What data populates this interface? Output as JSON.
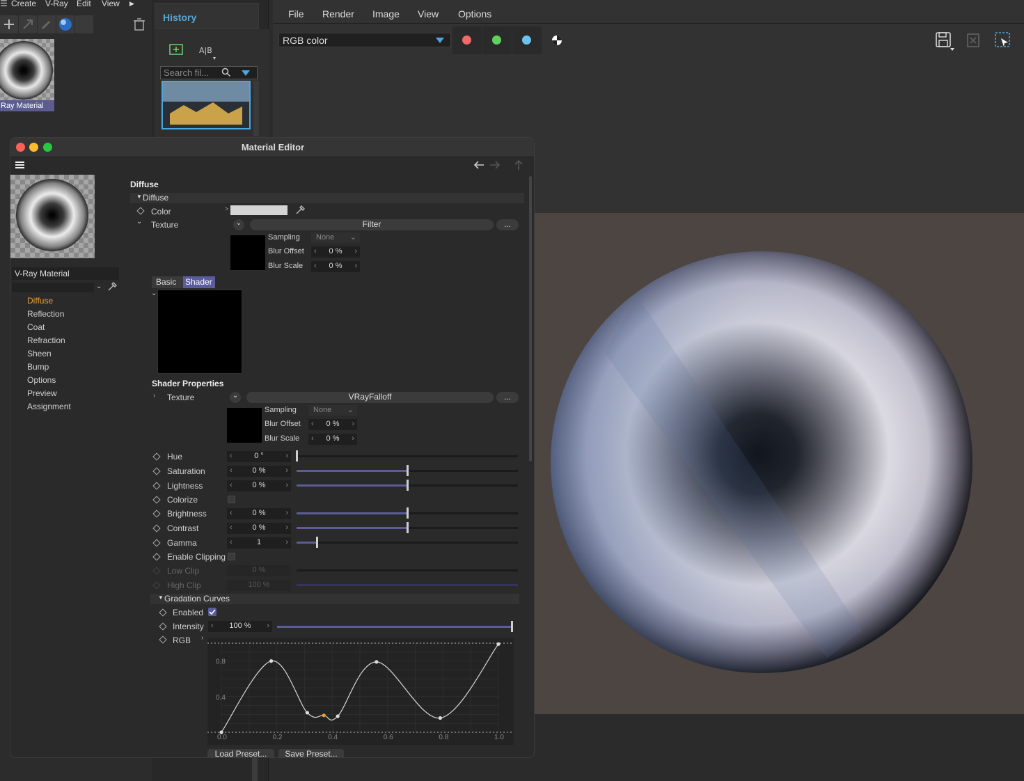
{
  "top_menu": {
    "items": [
      "Create",
      "V-Ray",
      "Edit",
      "View"
    ]
  },
  "thumb": {
    "label": "Ray Material"
  },
  "history": {
    "tab": "History",
    "search_placeholder": "Search fil..."
  },
  "viewport": {
    "menu": [
      "File",
      "Render",
      "Image",
      "View",
      "Options"
    ],
    "channel_select": "RGB color",
    "channel_colors": [
      "#f06a6a",
      "#5ed15e",
      "#6cc3ee"
    ]
  },
  "editor": {
    "title": "Material Editor",
    "material_name": "V-Ray Material",
    "nav": [
      "Diffuse",
      "Reflection",
      "Coat",
      "Refraction",
      "Sheen",
      "Bump",
      "Options",
      "Preview",
      "Assignment"
    ],
    "section_title": "Diffuse",
    "group_title": "Diffuse",
    "color_label": "Color",
    "texture_label": "Texture",
    "filter_label": "Filter",
    "more": "...",
    "sampling_label": "Sampling",
    "sampling_value": "None",
    "blur_offset_label": "Blur Offset",
    "blur_offset_value": "0 %",
    "blur_scale_label": "Blur Scale",
    "blur_scale_value": "0 %",
    "tabs": [
      "Basic",
      "Shader"
    ],
    "shader_props_title": "Shader Properties",
    "shader_texture_label": "Texture",
    "shader_name": "VRayFalloff",
    "sampling2_value": "None",
    "blur_offset2_value": "0 %",
    "blur_scale2_value": "0 %",
    "params": [
      {
        "label": "Hue",
        "value": "0 °",
        "level": 0.0
      },
      {
        "label": "Saturation",
        "value": "0 %",
        "level": 0.5
      },
      {
        "label": "Lightness",
        "value": "0 %",
        "level": 0.5
      },
      {
        "label": "Colorize",
        "value": "",
        "level": null
      },
      {
        "label": "Brightness",
        "value": "0 %",
        "level": 0.5
      },
      {
        "label": "Contrast",
        "value": "0 %",
        "level": 0.5
      },
      {
        "label": "Gamma",
        "value": "1",
        "level": 0.09
      },
      {
        "label": "Enable Clipping",
        "value": "",
        "level": null
      },
      {
        "label": "Low Clip",
        "value": "0 %",
        "level": 0.0
      },
      {
        "label": "High Clip",
        "value": "100 %",
        "level": 1.0
      }
    ],
    "gradation_title": "Gradation Curves",
    "enabled_label": "Enabled",
    "intensity_label": "Intensity",
    "intensity_value": "100 %",
    "intensity_level": 1.0,
    "rgb_label": "RGB",
    "load_preset": "Load Preset...",
    "save_preset": "Save Preset..."
  },
  "chart_data": {
    "type": "line",
    "x_ticks": [
      "0.0",
      "0.2",
      "0.4",
      "0.6",
      "0.8",
      "1.0"
    ],
    "y_ticks": [
      "0.4",
      "0.8"
    ],
    "xlim": [
      0,
      1
    ],
    "ylim": [
      0,
      1
    ],
    "points": [
      [
        0.0,
        0.0
      ],
      [
        0.18,
        0.8
      ],
      [
        0.31,
        0.22
      ],
      [
        0.37,
        0.19
      ],
      [
        0.42,
        0.18
      ],
      [
        0.56,
        0.79
      ],
      [
        0.79,
        0.16
      ],
      [
        1.0,
        0.99
      ]
    ]
  }
}
